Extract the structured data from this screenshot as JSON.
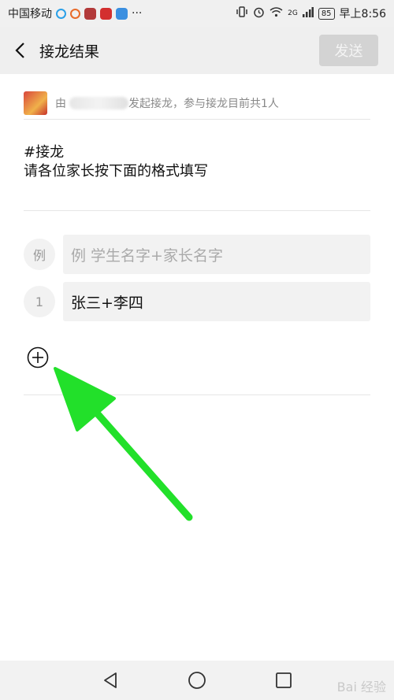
{
  "status_bar": {
    "carrier": "中国移动",
    "dots": "···",
    "network": "2G",
    "battery": "85",
    "time": "早上8:56",
    "app_icon_colors": [
      "#2aa0e8",
      "#e86b2a",
      "#b23a3a",
      "#d32f2f",
      "#3b8fe0"
    ]
  },
  "nav": {
    "title": "接龙结果",
    "send_label": "发送"
  },
  "info": {
    "prefix": "由",
    "suffix": "发起接龙，参与接龙目前共1人"
  },
  "topic": {
    "line1": "#接龙",
    "line2": "请各位家长按下面的格式填写"
  },
  "entries": [
    {
      "num": "例",
      "text": "例 学生名字+家长名字"
    },
    {
      "num": "1",
      "text": "张三+李四"
    }
  ],
  "watermark": "Bai 经验",
  "colors": {
    "arrow": "#22e02a",
    "send_bg": "#d3d3d3"
  }
}
